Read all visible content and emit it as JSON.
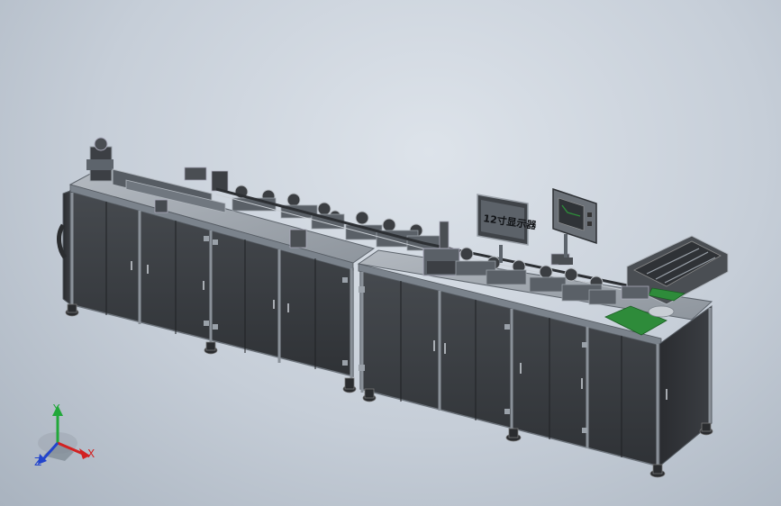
{
  "viewer": {
    "background_top": "#dde3ea",
    "background_bottom": "#a9b3bf"
  },
  "machine": {
    "cabinet_color": "#3a3d41",
    "frame_color": "#8c939b",
    "tabletop_color": "#9aa1a9",
    "accent_green": "#2e8b3a",
    "screen_label": "12寸显示器"
  },
  "axes": {
    "x_label": "X",
    "y_label": "Y",
    "z_label": "Z",
    "x_color": "#d22222",
    "y_color": "#22a83a",
    "z_color": "#2244cc"
  }
}
